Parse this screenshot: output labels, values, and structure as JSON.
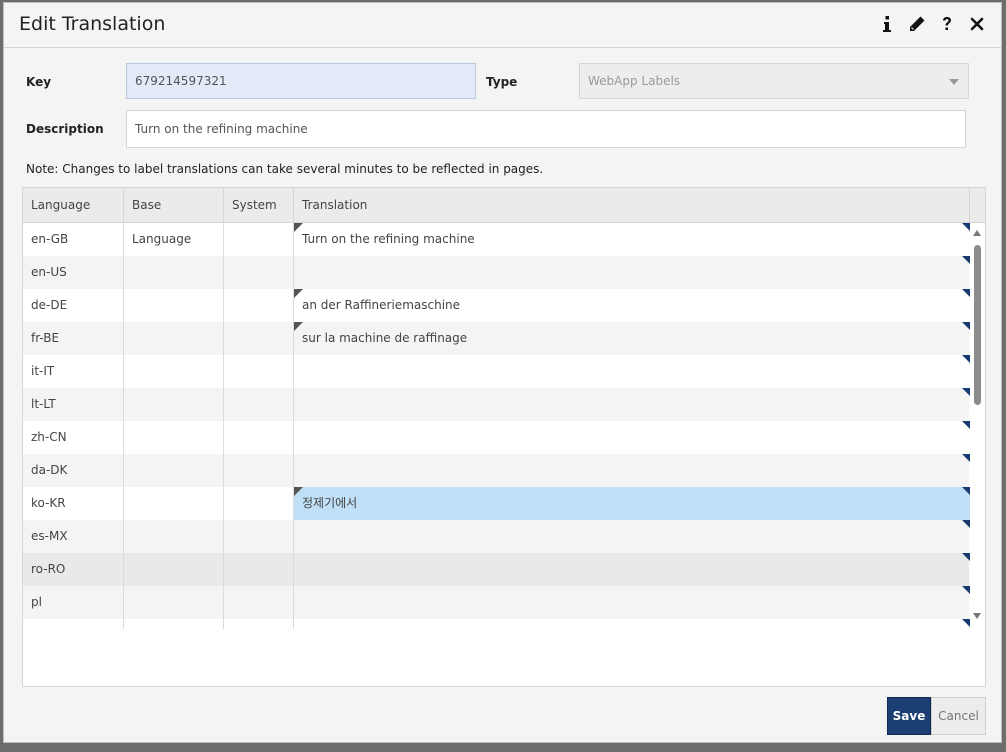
{
  "dialog": {
    "title": "Edit Translation",
    "icons": [
      "info-icon",
      "pencil-icon",
      "help-icon",
      "close-icon"
    ]
  },
  "form": {
    "key_label": "Key",
    "key_value": "679214597321",
    "type_label": "Type",
    "type_value": "WebApp Labels",
    "description_label": "Description",
    "description_value": "Turn on the refining machine",
    "note": "Note: Changes to label translations can take several minutes to be reflected in pages."
  },
  "grid": {
    "columns": [
      "Language",
      "Base Language",
      "System",
      "Translation"
    ],
    "rows": [
      {
        "language": "en-GB",
        "base": "",
        "system": "",
        "translation": "Turn on the refining machine"
      },
      {
        "language": "en-US",
        "base": "",
        "system": "",
        "translation": ""
      },
      {
        "language": "de-DE",
        "base": "",
        "system": "",
        "translation": "an der Raffineriemaschine"
      },
      {
        "language": "fr-BE",
        "base": "",
        "system": "",
        "translation": "sur la machine de raffinage"
      },
      {
        "language": "it-IT",
        "base": "",
        "system": "",
        "translation": ""
      },
      {
        "language": "lt-LT",
        "base": "",
        "system": "",
        "translation": ""
      },
      {
        "language": "zh-CN",
        "base": "",
        "system": "",
        "translation": ""
      },
      {
        "language": "da-DK",
        "base": "",
        "system": "",
        "translation": ""
      },
      {
        "language": "ko-KR",
        "base": "",
        "system": "",
        "translation": "정제기에서"
      },
      {
        "language": "es-MX",
        "base": "",
        "system": "",
        "translation": ""
      },
      {
        "language": "ro-RO",
        "base": "",
        "system": "",
        "translation": ""
      },
      {
        "language": "pl",
        "base": "",
        "system": "",
        "translation": ""
      }
    ]
  },
  "footer": {
    "save_label": "Save",
    "cancel_label": "Cancel"
  },
  "colors": {
    "save_button": "#1b3f73",
    "selected_cell": "#bfe0f7",
    "corner_marker": "#163b72"
  }
}
